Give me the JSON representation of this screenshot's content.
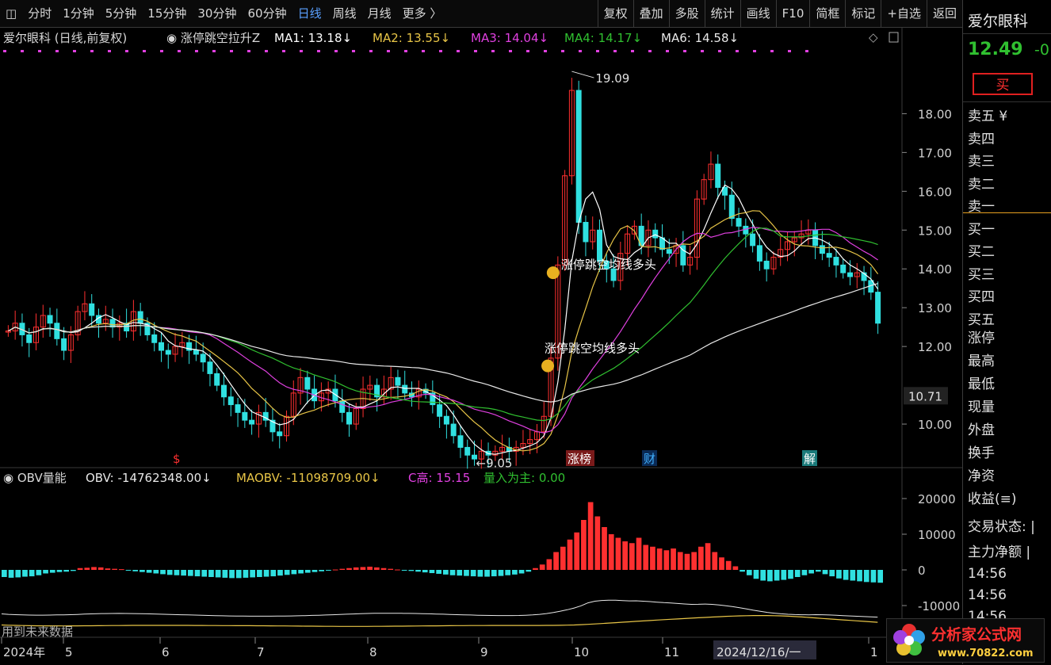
{
  "toolbar": {
    "left_items": [
      "分时",
      "1分钟",
      "5分钟",
      "15分钟",
      "30分钟",
      "60分钟",
      "日线",
      "周线",
      "月线",
      "更多 〉"
    ],
    "active_index": 6,
    "right_items": [
      "复权",
      "叠加",
      "多股",
      "统计",
      "画线",
      "F10",
      "简框",
      "标记",
      "+自选",
      "返回"
    ]
  },
  "main_header": {
    "stock": "爱尔眼科 (日线,前复权)",
    "formula": "涨停跳空拉升Z",
    "ma": [
      {
        "label": "MA1: 13.18↓",
        "color": "#ffffff"
      },
      {
        "label": "MA2: 13.55↓",
        "color": "#e8c547"
      },
      {
        "label": "MA3: 14.04↓",
        "color": "#e040e0"
      },
      {
        "label": "MA4: 14.17↓",
        "color": "#30c030"
      },
      {
        "label": "MA6: 14.58↓",
        "color": "#e8e8e8"
      }
    ]
  },
  "price_axis": [
    "18.00",
    "17.00",
    "16.00",
    "15.00",
    "14.00",
    "13.00",
    "12.00",
    "10.00"
  ],
  "price_marker": "10.71",
  "annotations": {
    "high_label": "19.09",
    "low_label": "9.05",
    "signal_text": "涨停跳空均线多头",
    "event_markers": [
      {
        "text": "$",
        "color": "#ff3030"
      },
      {
        "text": "涨榜",
        "color": "#ffffff",
        "bg": "#7a1a1a"
      },
      {
        "text": "财",
        "color": "#40b0ff",
        "bg": "#0a2a55"
      },
      {
        "text": "解",
        "color": "#ffffff",
        "bg": "#1a7a7a"
      }
    ]
  },
  "obv_header": {
    "name": "OBV量能",
    "obv": "OBV: -14762348.00↓",
    "maobv": "MAOBV: -11098709.00↓",
    "chigh": "C高: 15.15",
    "volume": "量入为主: 0.00"
  },
  "obv_axis": [
    "20000",
    "10000",
    "0",
    "-10000"
  ],
  "future_data_note": "用到未来数据",
  "date_axis": {
    "labels": [
      "2024年",
      "5",
      "6",
      "7",
      "8",
      "9",
      "10",
      "11",
      "1"
    ],
    "cursor_date": "2024/12/16/一"
  },
  "sidebar": {
    "name": "爱尔眼科",
    "price": "12.49",
    "change": "-0",
    "buy": "买",
    "order_book": [
      "卖五 ¥",
      "卖四",
      "卖三",
      "卖二",
      "卖一",
      "买一",
      "买二",
      "买三",
      "买四",
      "买五"
    ],
    "stats": [
      "涨停",
      "最高",
      "最低",
      "现量",
      "外盘",
      "换手",
      "净资",
      "收益(≡)"
    ],
    "trade_status": "交易状态: |",
    "main_flow": "主力净额 |",
    "times": [
      "14:56",
      "14:56",
      "14:56"
    ]
  },
  "logo": {
    "name": "分析家公式网",
    "url": "www.70822.com"
  },
  "colors": {
    "up": "#ff3030",
    "down": "#30e0e0",
    "accent": "#5aa0ff",
    "ma1": "#ffffff",
    "ma2": "#e8c547",
    "ma3": "#e040e0",
    "ma4": "#30c030",
    "ma6": "#e8e8e8"
  },
  "chart_data": {
    "type": "candlestick",
    "price_ylim": [
      9.0,
      19.5
    ],
    "closes": [
      12.4,
      12.6,
      12.3,
      12.1,
      12.5,
      12.8,
      12.6,
      12.2,
      11.9,
      12.3,
      12.9,
      13.1,
      12.8,
      12.6,
      12.7,
      12.5,
      12.6,
      12.4,
      12.9,
      12.6,
      12.3,
      12.1,
      11.9,
      11.8,
      12.0,
      12.1,
      11.9,
      11.8,
      11.6,
      11.3,
      11.0,
      10.7,
      10.5,
      10.3,
      10.1,
      10.0,
      10.3,
      10.1,
      9.8,
      9.7,
      10.2,
      10.8,
      11.2,
      10.9,
      10.6,
      10.8,
      10.9,
      10.6,
      10.3,
      10.0,
      10.4,
      10.9,
      11.0,
      10.7,
      10.9,
      11.2,
      11.0,
      10.8,
      10.7,
      10.9,
      10.8,
      10.5,
      10.2,
      10.0,
      9.7,
      9.4,
      9.2,
      9.1,
      9.3,
      9.2,
      9.3,
      9.4,
      9.3,
      9.4,
      9.5,
      9.6,
      9.8,
      10.2,
      11.7,
      14.1,
      16.4,
      18.6,
      15.2,
      14.7,
      15.0,
      14.2,
      14.0,
      13.7,
      14.4,
      14.9,
      15.1,
      14.6,
      15.0,
      14.8,
      14.5,
      14.4,
      14.6,
      14.1,
      14.3,
      15.8,
      16.3,
      16.7,
      16.1,
      15.9,
      15.3,
      15.1,
      14.9,
      14.6,
      14.2,
      14.0,
      14.3,
      14.5,
      14.7,
      14.8,
      14.9,
      15.0,
      14.6,
      14.4,
      14.3,
      14.1,
      13.9,
      13.8,
      13.9,
      13.7,
      13.4,
      12.6
    ],
    "obv_bar_values": [
      -2000,
      -2200,
      -2100,
      -1900,
      -1800,
      -1500,
      -1000,
      -800,
      -600,
      -500,
      -300,
      500,
      600,
      800,
      700,
      400,
      300,
      200,
      -200,
      -400,
      -600,
      -800,
      -1000,
      -1200,
      -1400,
      -1500,
      -1600,
      -1700,
      -1800,
      -1900,
      -2000,
      -2100,
      -2200,
      -2300,
      -2300,
      -2200,
      -2100,
      -2000,
      -1900,
      -1800,
      -1600,
      -1400,
      -1200,
      -1000,
      -800,
      -600,
      -400,
      -200,
      100,
      300,
      500,
      700,
      800,
      900,
      700,
      500,
      300,
      100,
      -100,
      -300,
      -500,
      -700,
      -900,
      -1100,
      -1300,
      -1500,
      -1600,
      -1700,
      -1800,
      -1900,
      -1900,
      -1800,
      -1700,
      -1500,
      -1300,
      -1000,
      -500,
      500,
      1500,
      3000,
      5000,
      6500,
      8500,
      10500,
      14000,
      19000,
      15000,
      12000,
      10000,
      9000,
      8000,
      7500,
      9000,
      7000,
      6500,
      6000,
      5500,
      6000,
      5000,
      4500,
      5000,
      6500,
      7500,
      5000,
      3500,
      2500,
      1000,
      -500,
      -1500,
      -2500,
      -3000,
      -3200,
      -3000,
      -2800,
      -2500,
      -2000,
      -1500,
      -1000,
      -500,
      -1200,
      -1800,
      -2400,
      -2800,
      -3000,
      -3200,
      -3400,
      -3500,
      -3600
    ],
    "obv_ylim": [
      -18000,
      22000
    ]
  }
}
